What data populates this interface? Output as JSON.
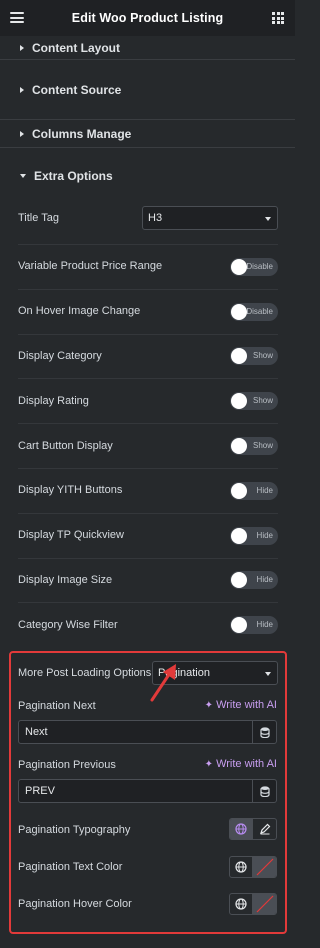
{
  "header": {
    "title": "Edit Woo Product Listing",
    "menu_icon": "hamburger-icon",
    "apps_icon": "grid-icon"
  },
  "sections": [
    {
      "label": "Content Layout",
      "expanded": false
    },
    {
      "label": "Content Source",
      "expanded": false
    },
    {
      "label": "Columns Manage",
      "expanded": false
    },
    {
      "label": "Extra Options",
      "expanded": true
    }
  ],
  "extra": {
    "title_tag": {
      "label": "Title Tag",
      "value": "H3"
    },
    "toggles": [
      {
        "label": "Variable Product Price Range",
        "text": "Disable"
      },
      {
        "label": "On Hover Image Change",
        "text": "Disable"
      },
      {
        "label": "Display Category",
        "text": "Show"
      },
      {
        "label": "Display Rating",
        "text": "Show"
      },
      {
        "label": "Cart Button Display",
        "text": "Show"
      },
      {
        "label": "Display YITH Buttons",
        "text": "Hide"
      },
      {
        "label": "Display TP Quickview",
        "text": "Hide"
      },
      {
        "label": "Display Image Size",
        "text": "Hide"
      },
      {
        "label": "Category Wise Filter",
        "text": "Hide"
      }
    ],
    "loading": {
      "label": "More Post Loading Options",
      "value": "Pagination"
    },
    "pagination_next": {
      "label": "Pagination Next",
      "ai": "Write with AI",
      "value": "Next"
    },
    "pagination_prev": {
      "label": "Pagination Previous",
      "ai": "Write with AI",
      "value": "PREV"
    },
    "typography": {
      "label": "Pagination Typography"
    },
    "text_color": {
      "label": "Pagination Text Color"
    },
    "hover_color": {
      "label": "Pagination Hover Color"
    }
  },
  "colors": {
    "highlight": "#e23a3a",
    "ai_accent": "#c89ef0",
    "panel_bg": "#26292c",
    "header_bg": "#1f2124"
  }
}
